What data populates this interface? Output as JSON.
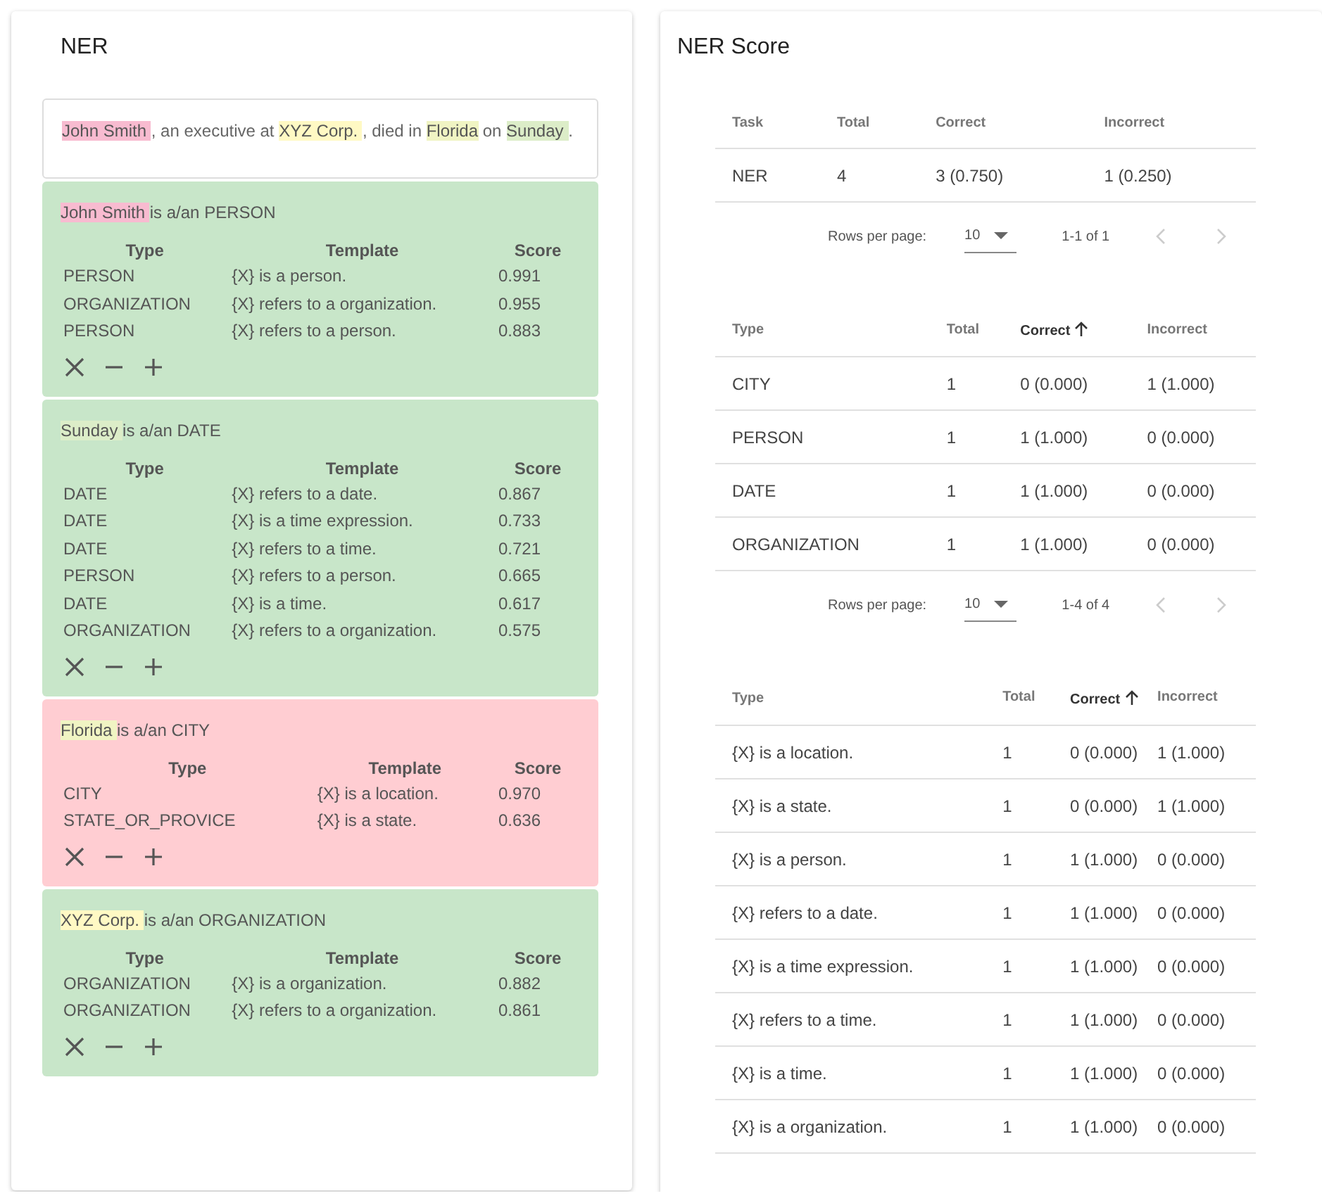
{
  "ner": {
    "title": "NER",
    "sentence": [
      {
        "text": "John Smith ",
        "color": "#f8bbd0"
      },
      {
        "text": ", an executive at "
      },
      {
        "text": "XYZ Corp. ",
        "color": "#fff9c4"
      },
      {
        "text": ", died in "
      },
      {
        "text": "Florida",
        "color": "#f0f4c3"
      },
      {
        "text": " on "
      },
      {
        "text": "Sunday ",
        "color": "#dcedc8"
      },
      {
        "text": "."
      }
    ],
    "cards": [
      {
        "color": "#c8e6c9",
        "entity": {
          "text": "John Smith ",
          "color": "#f8bbd0"
        },
        "label": "is a/an PERSON",
        "columns": [
          "Type",
          "Template",
          "Score"
        ],
        "rows": [
          [
            "PERSON",
            "{X} is a person.",
            "0.991"
          ],
          [
            "ORGANIZATION",
            "{X} refers to a organization.",
            "0.955"
          ],
          [
            "PERSON",
            "{X} refers to a person.",
            "0.883"
          ]
        ]
      },
      {
        "color": "#c8e6c9",
        "entity": {
          "text": "Sunday ",
          "color": "#dcedc8"
        },
        "label": "is a/an DATE",
        "columns": [
          "Type",
          "Template",
          "Score"
        ],
        "rows": [
          [
            "DATE",
            "{X} refers to a date.",
            "0.867"
          ],
          [
            "DATE",
            "{X} is a time expression.",
            "0.733"
          ],
          [
            "DATE",
            "{X} refers to a time.",
            "0.721"
          ],
          [
            "PERSON",
            "{X} refers to a person.",
            "0.665"
          ],
          [
            "DATE",
            "{X} is a time.",
            "0.617"
          ],
          [
            "ORGANIZATION",
            "{X} refers to a organization.",
            "0.575"
          ]
        ]
      },
      {
        "color": "#ffcdd2",
        "entity": {
          "text": "Florida ",
          "color": "#f0f4c3"
        },
        "label": "is a/an CITY",
        "columns": [
          "Type",
          "Template",
          "Score"
        ],
        "rows": [
          [
            "CITY",
            "{X} is a location.",
            "0.970"
          ],
          [
            "STATE_OR_PROVICE",
            "{X} is a state.",
            "0.636"
          ]
        ]
      },
      {
        "color": "#c8e6c9",
        "entity": {
          "text": "XYZ Corp. ",
          "color": "#fff9c4"
        },
        "label": "is a/an ORGANIZATION",
        "columns": [
          "Type",
          "Template",
          "Score"
        ],
        "rows": [
          [
            "ORGANIZATION",
            "{X} is a organization.",
            "0.882"
          ],
          [
            "ORGANIZATION",
            "{X} refers to a organization.",
            "0.861"
          ]
        ]
      }
    ]
  },
  "score": {
    "title": "NER Score",
    "tables": [
      {
        "columns": [
          {
            "label": "Task",
            "sorted": false
          },
          {
            "label": "Total",
            "sorted": false
          },
          {
            "label": "Correct",
            "sorted": false
          },
          {
            "label": "Incorrect",
            "sorted": false
          }
        ],
        "rows": [
          [
            "NER",
            "4",
            "3 (0.750)",
            "1 (0.250)"
          ]
        ],
        "pagination": {
          "rows_per_page_label": "Rows per page:",
          "rows_per_page": "10",
          "range": "1-1 of 1",
          "prev_disabled": true,
          "next_disabled": true
        }
      },
      {
        "columns": [
          {
            "label": "Type",
            "sorted": false
          },
          {
            "label": "Total",
            "sorted": false
          },
          {
            "label": "Correct",
            "sorted": true
          },
          {
            "label": "Incorrect",
            "sorted": false
          }
        ],
        "rows": [
          [
            "CITY",
            "1",
            "0 (0.000)",
            "1 (1.000)"
          ],
          [
            "PERSON",
            "1",
            "1 (1.000)",
            "0 (0.000)"
          ],
          [
            "DATE",
            "1",
            "1 (1.000)",
            "0 (0.000)"
          ],
          [
            "ORGANIZATION",
            "1",
            "1 (1.000)",
            "0 (0.000)"
          ]
        ],
        "pagination": {
          "rows_per_page_label": "Rows per page:",
          "rows_per_page": "10",
          "range": "1-4 of 4",
          "prev_disabled": true,
          "next_disabled": true
        }
      },
      {
        "columns": [
          {
            "label": "Type",
            "sorted": false
          },
          {
            "label": "Total",
            "sorted": false
          },
          {
            "label": "Correct",
            "sorted": true
          },
          {
            "label": "Incorrect",
            "sorted": false
          }
        ],
        "rows": [
          [
            "{X} is a location.",
            "1",
            "0 (0.000)",
            "1 (1.000)"
          ],
          [
            "{X} is a state.",
            "1",
            "0 (0.000)",
            "1 (1.000)"
          ],
          [
            "{X} is a person.",
            "1",
            "1 (1.000)",
            "0 (0.000)"
          ],
          [
            "{X} refers to a date.",
            "1",
            "1 (1.000)",
            "0 (0.000)"
          ],
          [
            "{X} is a time expression.",
            "1",
            "1 (1.000)",
            "0 (0.000)"
          ],
          [
            "{X} refers to a time.",
            "1",
            "1 (1.000)",
            "0 (0.000)"
          ],
          [
            "{X} is a time.",
            "1",
            "1 (1.000)",
            "0 (0.000)"
          ],
          [
            "{X} is a organization.",
            "1",
            "1 (1.000)",
            "0 (0.000)"
          ]
        ]
      }
    ]
  }
}
